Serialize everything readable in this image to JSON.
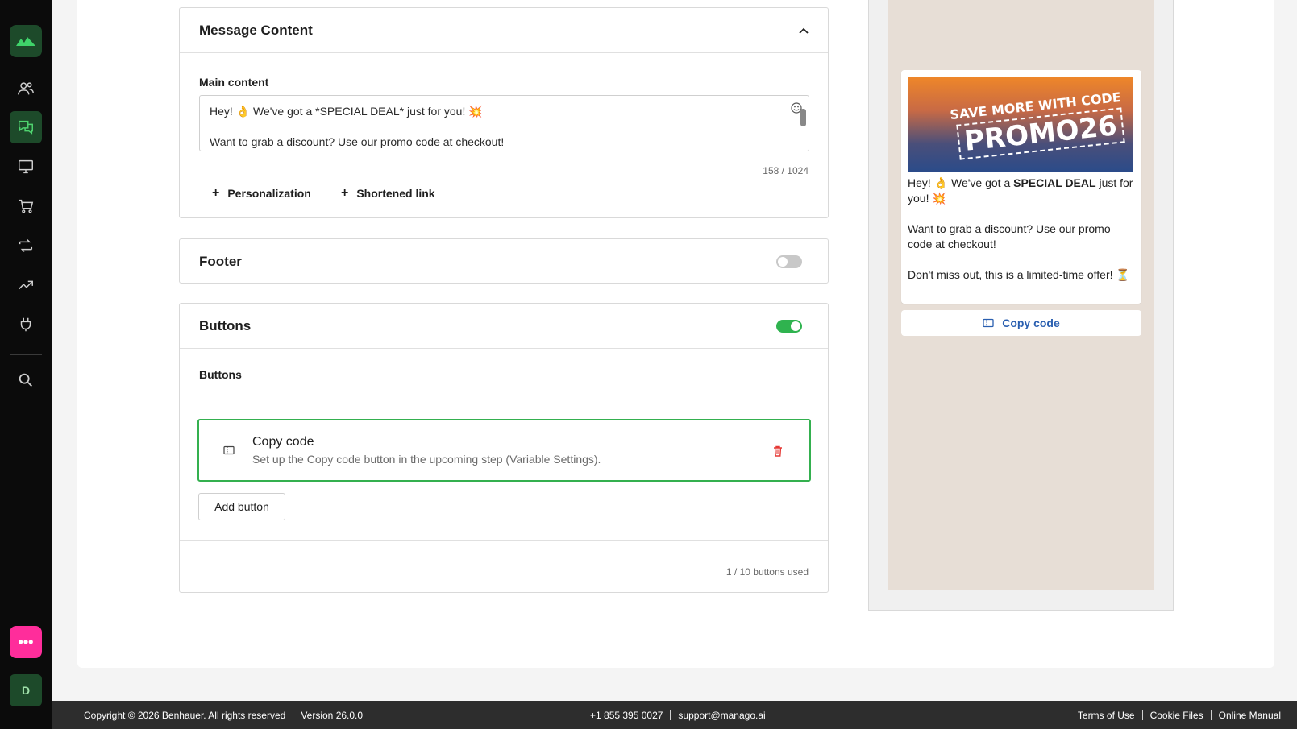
{
  "sidebar": {
    "avatar_initial": "D",
    "chat_label": "•••"
  },
  "message_panel": {
    "title": "Message Content",
    "field_label": "Main content",
    "line1": "Hey! 👌 We've got a *SPECIAL DEAL* just for you! 💥",
    "line2": "Want to grab a discount? Use our promo code at checkout!",
    "counter": "158 / 1024",
    "personalization": "Personalization",
    "shortened_link": "Shortened link"
  },
  "footer_panel": {
    "title": "Footer",
    "enabled": false
  },
  "buttons_panel": {
    "title": "Buttons",
    "enabled": true,
    "section_label": "Buttons",
    "copy_title": "Copy code",
    "copy_desc": "Set up the Copy code button in the upcoming step (Variable Settings).",
    "add_button": "Add button",
    "used": "1 / 10 buttons used"
  },
  "preview": {
    "promo_top": "SAVE MORE WITH CODE",
    "promo_code": "PROMO26",
    "text_1a": "Hey! 👌 We've got a ",
    "text_1b": "SPECIAL DEAL",
    "text_1c": " just for you! 💥",
    "text_2": "Want to grab a discount? Use our promo code at checkout!",
    "text_3": "Don't miss out, this is a limited-time offer! ⏳",
    "copy_reply": "Copy code"
  },
  "footer_bar": {
    "copyright": "Copyright © 2026 Benhauer. All rights reserved",
    "version": "Version 26.0.0",
    "phone": "+1 855 395 0027",
    "email": "support@manago.ai",
    "terms": "Terms of Use",
    "cookies": "Cookie Files",
    "manual": "Online Manual"
  },
  "colors": {
    "accent_green": "#2fb34f",
    "sidebar_bg": "#0b0b0b",
    "link_blue": "#2a5fb0",
    "delete_red": "#e53935"
  }
}
